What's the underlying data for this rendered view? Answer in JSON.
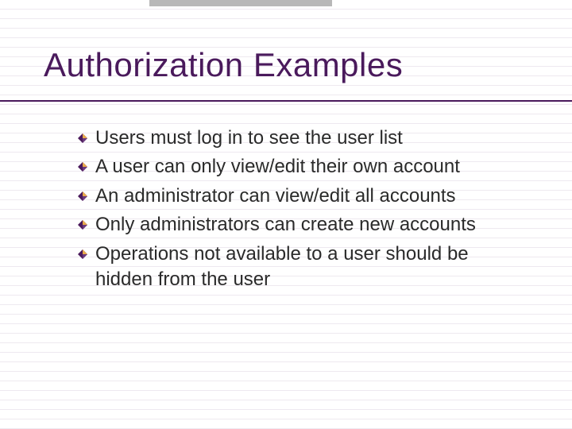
{
  "title": "Authorization Examples",
  "bullets": [
    "Users must log in to see the user list",
    "A user can only view/edit their own account",
    "An administrator can view/edit all accounts",
    "Only administrators can create new accounts",
    "Operations not available to a user should be hidden from the user"
  ]
}
